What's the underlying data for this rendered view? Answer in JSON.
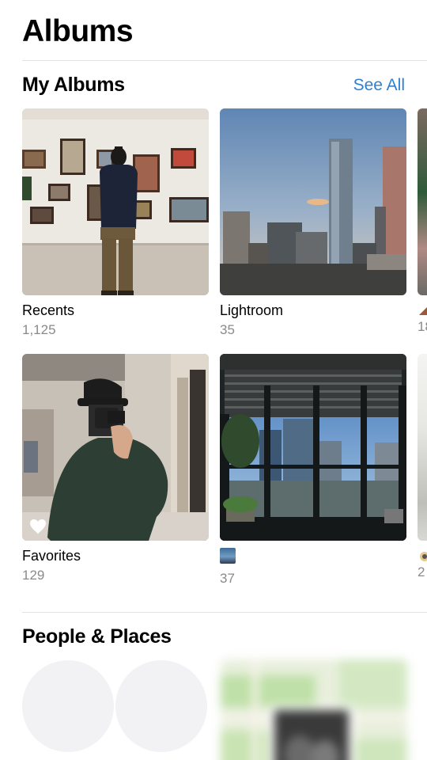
{
  "header": {
    "title": "Albums"
  },
  "my_albums": {
    "title": "My Albums",
    "see_all": "See All",
    "albums": [
      {
        "name": "Recents",
        "count": "1,125",
        "thumb": "gallery-visitor-photo"
      },
      {
        "name": "Lightroom",
        "count": "35",
        "thumb": "city-skyline-photo"
      },
      {
        "name": "",
        "count": "18",
        "thumb": "partial-album-photo"
      },
      {
        "name": "Favorites",
        "count": "129",
        "thumb": "mirror-selfie-photo",
        "badge": "heart-icon"
      },
      {
        "name": "",
        "name_icon": "album-image-icon",
        "count": "37",
        "thumb": "window-view-photo"
      },
      {
        "name": "",
        "count": "2",
        "thumb": "partial-album-photo"
      }
    ]
  },
  "people_places": {
    "title": "People & Places"
  },
  "colors": {
    "accent": "#2f7fd1",
    "secondary_text": "#8a8a8e",
    "divider": "#e3e3e6"
  }
}
